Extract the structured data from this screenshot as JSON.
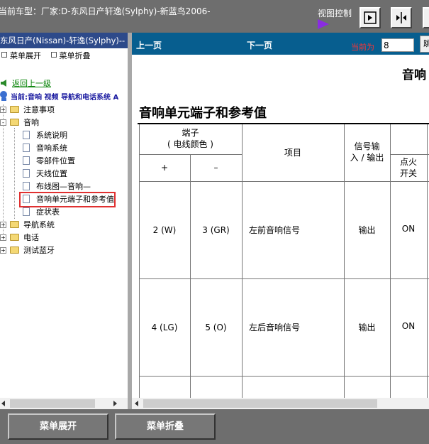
{
  "header": {
    "car_model": "当前车型：厂家:D-东风日产轩逸(Sylphy)-新蓝鸟2006-",
    "view_control_label": "视图控制"
  },
  "left_panel": {
    "title": "东风日产(Nissan)-轩逸(Sylphy)--",
    "menu_expand": "菜单展开",
    "menu_collapse": "菜单折叠",
    "back_label": "返回上一级",
    "current_path": "当前:音响 视频 导航和电话系统 A",
    "tree": [
      {
        "label": "注意事项",
        "type": "folder",
        "expand": "+"
      },
      {
        "label": "音响",
        "type": "folder",
        "expand": "-"
      },
      {
        "label": "系统说明",
        "type": "page"
      },
      {
        "label": "音响系统",
        "type": "page"
      },
      {
        "label": "零部件位置",
        "type": "page"
      },
      {
        "label": "天线位置",
        "type": "page"
      },
      {
        "label": "布线图—音响—",
        "type": "page"
      },
      {
        "label": "音响单元端子和参考值",
        "type": "page",
        "selected": true
      },
      {
        "label": "症状表",
        "type": "page"
      },
      {
        "label": "导航系统",
        "type": "folder",
        "expand": "+"
      },
      {
        "label": "电话",
        "type": "folder",
        "expand": "+"
      },
      {
        "label": "测试蓝牙",
        "type": "folder",
        "expand": "+"
      }
    ]
  },
  "navbar": {
    "prev": "上一页",
    "next": "下一页",
    "current_label": "当前为",
    "page_value": "8",
    "jump_label": "跳"
  },
  "document": {
    "partial_title": "音响",
    "title": "音响单元端子和参考值",
    "headers": {
      "terminal": "端子",
      "wire_color": "( 电线颜色 )",
      "plus": "+",
      "minus": "–",
      "item": "项目",
      "signal_io_1": "信号输",
      "signal_io_2": "入 / 输出",
      "ignition_1": "点火",
      "ignition_2": "开关"
    },
    "rows": [
      {
        "plus": "2 (W)",
        "minus": "3 (GR)",
        "item": "左前音响信号",
        "io": "输出",
        "ignition": "ON"
      },
      {
        "plus": "4 (LG)",
        "minus": "5 (O)",
        "item": "左后音响信号",
        "io": "输出",
        "ignition": "ON"
      }
    ]
  },
  "bottom": {
    "expand_all": "菜单展开",
    "collapse_all": "菜单折叠"
  }
}
